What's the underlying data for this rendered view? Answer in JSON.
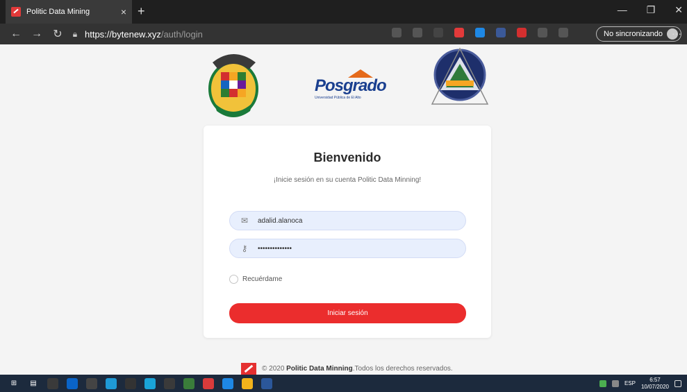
{
  "browser": {
    "tab_title": "Politic Data Mining",
    "tab_close": "×",
    "new_tab": "+",
    "url_host": "https://bytenew.xyz",
    "url_path": "/auth/login",
    "sync_label": "No sincronizando",
    "window_controls": [
      "—",
      "❐",
      "✕"
    ]
  },
  "page": {
    "logos": {
      "posgrado_title": "Posgrado",
      "posgrado_subtitle": "Universidad Pública de El Alto"
    },
    "card": {
      "title": "Bienvenido",
      "subtitle": "¡Inicie sesión en su cuenta Politic Data Minning!",
      "email_value": "adalid.alanoca",
      "password_value": "••••••••••••••",
      "remember_label": "Recuérdame",
      "submit_label": "Iniciar sesión"
    },
    "footer": {
      "prefix": "© 2020 ",
      "brand": "Politic Data Minning",
      "suffix": ".Todos los derechos reservados."
    }
  },
  "taskbar": {
    "language": "ESP",
    "time": "6:57",
    "date": "10/07/2020"
  },
  "colors": {
    "accent": "#eb2d2d",
    "input_bg": "#e8effd",
    "taskbar": "#1c2a3d"
  }
}
